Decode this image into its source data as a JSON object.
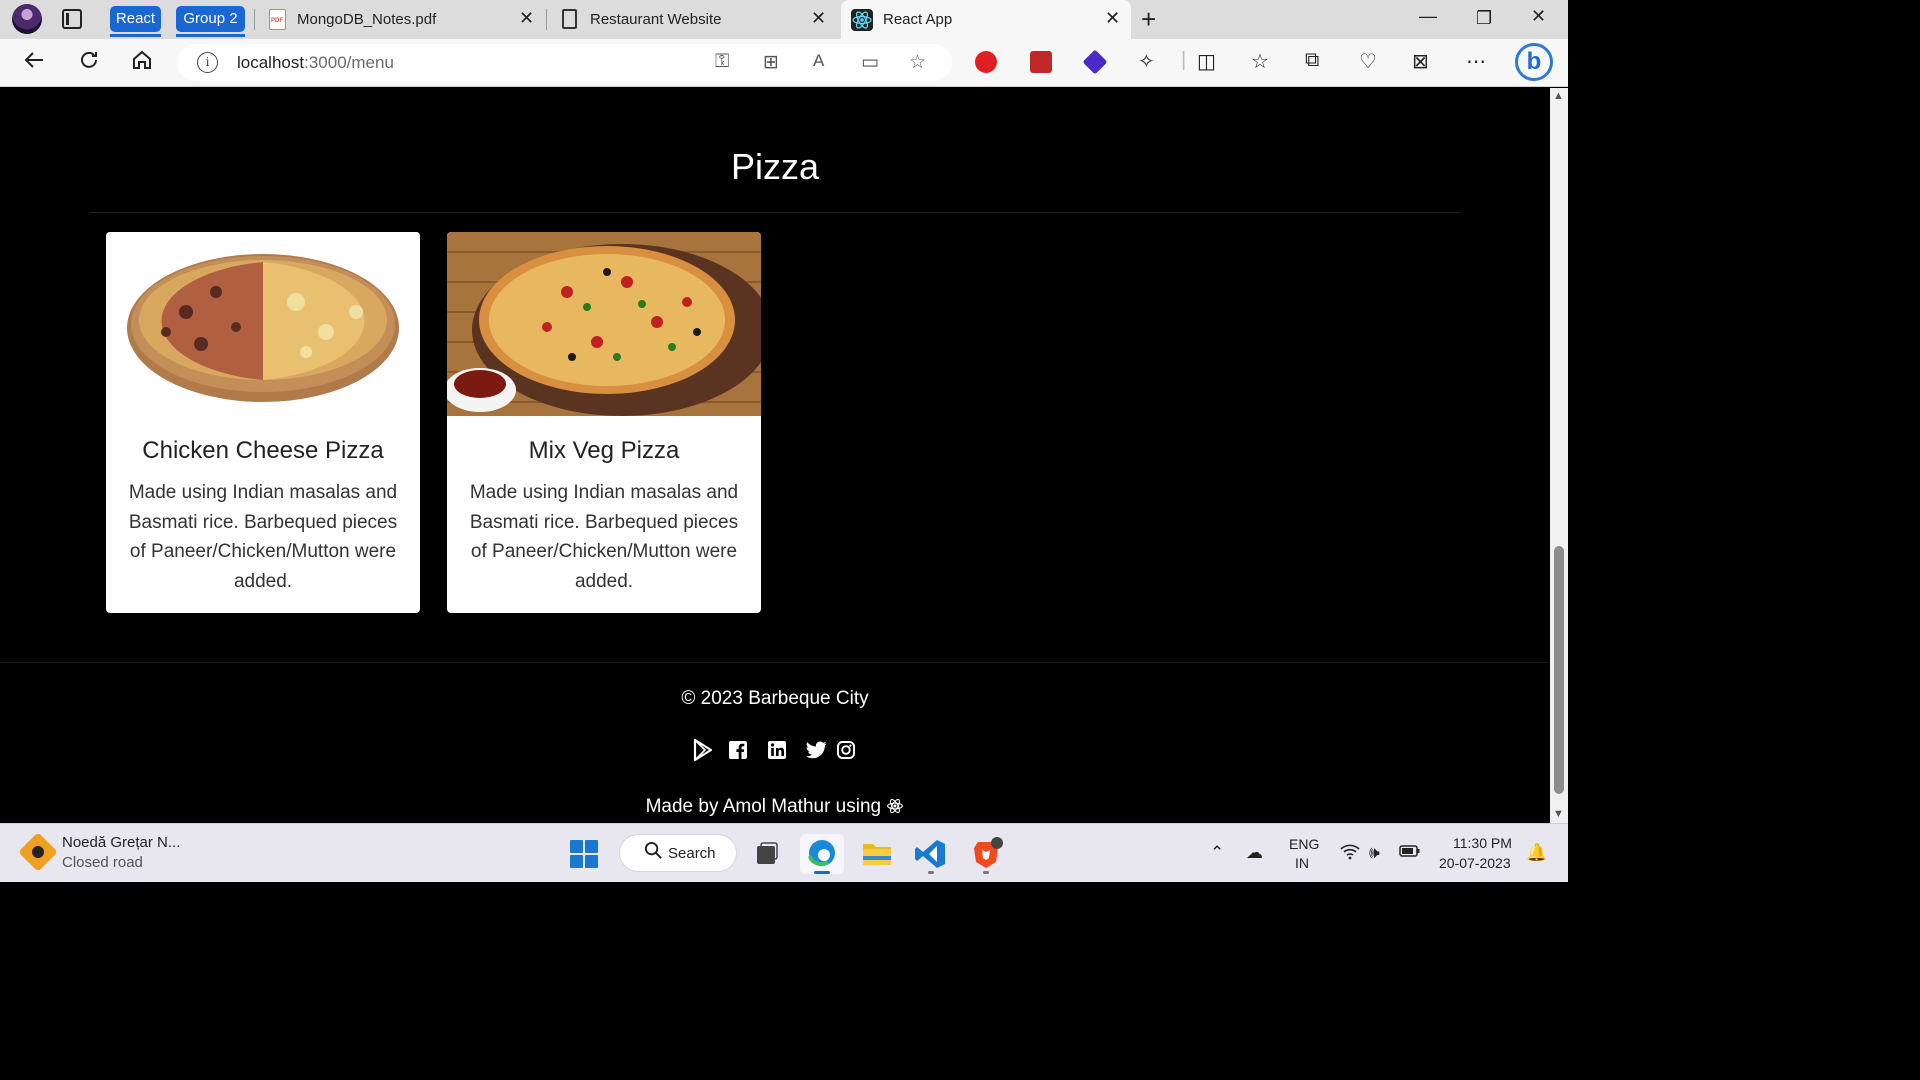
{
  "browser": {
    "tab_groups": [
      {
        "label": "React",
        "color": "#1967d2"
      },
      {
        "label": "Group 2",
        "color": "#1967d2"
      }
    ],
    "tabs": [
      {
        "title": "MongoDB_Notes.pdf",
        "icon": "pdf-icon",
        "active": false
      },
      {
        "title": "Restaurant Website",
        "icon": "document-icon",
        "active": false
      },
      {
        "title": "React App",
        "icon": "react-icon",
        "active": true
      }
    ],
    "url_host": "localhost",
    "url_path": ":3000/menu"
  },
  "page": {
    "category_title": "Pizza",
    "items": [
      {
        "name": "Chicken Cheese Pizza",
        "description": "Made using Indian masalas and Basmati rice. Barbequed pieces of Paneer/Chicken/Mutton were added.",
        "image": "chicken-cheese-pizza-image"
      },
      {
        "name": "Mix Veg Pizza",
        "description": "Made using Indian masalas and Basmati rice. Barbequed pieces of Paneer/Chicken/Mutton were added.",
        "image": "mix-veg-pizza-image"
      }
    ],
    "footer": {
      "copyright": "© 2023 Barbeque City",
      "social_icons": [
        "google-play-icon",
        "facebook-icon",
        "linkedin-icon",
        "twitter-icon",
        "instagram-icon"
      ],
      "made_by": "Made by Amol Mathur using"
    }
  },
  "taskbar": {
    "weather_title": "Noedă Grețar N...",
    "weather_subtitle": "Closed road",
    "search_label": "Search",
    "lang_line1": "ENG",
    "lang_line2": "IN",
    "time": "11:30 PM",
    "date": "20-07-2023"
  },
  "colors": {
    "page_background": "#000000",
    "card_background": "#ffffff",
    "tab_group": "#1967d2"
  }
}
